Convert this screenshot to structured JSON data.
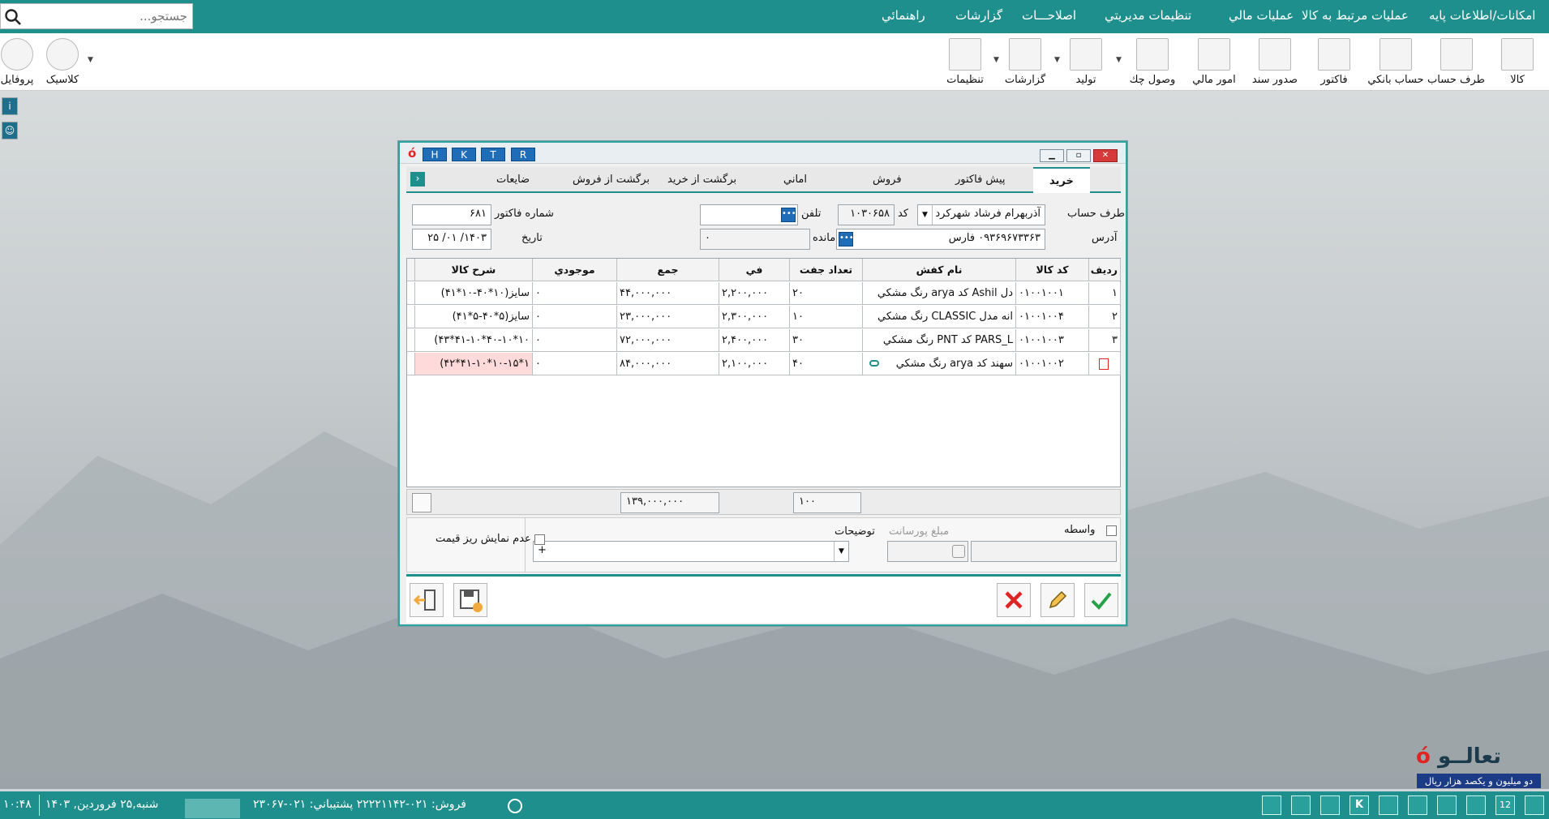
{
  "menu": {
    "items": [
      "امکانات/اطلاعات پايه",
      "عمليات مرتبط به کالا",
      "عمليات مالي",
      "تنظيمات مديريتي",
      "اصلاحـــات",
      "گزارشات",
      "راهنمائي"
    ],
    "search_placeholder": "جستجو..."
  },
  "toolbar": {
    "items": [
      "کالا",
      "طرف حساب",
      "حساب بانکي",
      "فاکتور",
      "صدور سند",
      "امور مالي",
      "وصول چك",
      "توليد",
      "گزارشات",
      "تنظيمات"
    ],
    "theme_label": "کلاسيک",
    "profile_label": "پروفايل"
  },
  "dialog": {
    "title_buttons": [
      "H",
      "K",
      "T",
      "R"
    ],
    "tabs": [
      "خريد",
      "پيش فاکتور",
      "فروش",
      "اماني",
      "برگشت از خريد",
      "برگشت از فروش",
      "ضايعات"
    ],
    "active_tab": "خريد",
    "form": {
      "account_label": "طرف حساب",
      "account_value": "آذربهرام فرشاد شهرکرد",
      "code_label": "کد",
      "code_value": "۱۰۳۰۶۵۸",
      "phone_label": "تلفن",
      "phone_value": "",
      "invoice_no_label": "شماره فاکتور",
      "invoice_no_value": "۶۸۱",
      "address_label": "آدرس",
      "address_value": "۰۹۳۶۹۶۷۳۳۶۳   فارس",
      "balance_label": "مانده",
      "balance_value": "۰",
      "date_label": "تاريخ",
      "date_value": "۱۴۰۳/ ۰۱/ ۲۵"
    },
    "table": {
      "headers": [
        "رديف",
        "کد کالا",
        "نام کفش",
        "تعداد جفت",
        "في",
        "جمع",
        "موجودي",
        "شرح کالا"
      ],
      "rows": [
        [
          "۱",
          "۰۱۰۰۱۰۰۱",
          "دل Ashil کد arya رنگ مشکي",
          "۲۰",
          "۲,۲۰۰,۰۰۰",
          "۴۴,۰۰۰,۰۰۰",
          "۰",
          "سايز(۱۰*۴۰-۱۰*۴۱)"
        ],
        [
          "۲",
          "۰۱۰۰۱۰۰۴",
          "انه مدل CLASSIC رنگ مشکي",
          "۱۰",
          "۲,۳۰۰,۰۰۰",
          "۲۳,۰۰۰,۰۰۰",
          "۰",
          "سايز(۵*۴۰-۵*۴۱)"
        ],
        [
          "۳",
          "۰۱۰۰۱۰۰۳",
          "PARS_L کد PNT رنگ مشکي",
          "۳۰",
          "۲,۴۰۰,۰۰۰",
          "۷۲,۰۰۰,۰۰۰",
          "۰",
          "۱۰*۴۰-۱۰*۴۱-۱۰*۴۳)"
        ],
        [
          "",
          "۰۱۰۰۱۰۰۲",
          "سهند کد arya رنگ مشکي",
          "۴۰",
          "۲,۱۰۰,۰۰۰",
          "۸۴,۰۰۰,۰۰۰",
          "۰",
          "۱*۱۰-۱۵*۴۱-۱۰*۴۲)"
        ]
      ]
    },
    "totals": {
      "pairs_total": "۱۰۰",
      "amount_total": "۱۳۹,۰۰۰,۰۰۰"
    },
    "bottom": {
      "intermediary_label": "واسطه",
      "commission_label": "مبلغ پورسانت",
      "notes_label": "توضيحات",
      "notes_value": "+",
      "hide_price_label": "عدم نمايش ريز قيمت"
    }
  },
  "brand": {
    "logo_text": "تعالــو",
    "amount_in_words": "دو ميليون  و يکصد هزار  ريال"
  },
  "status": {
    "datetime": "شنبه,۲۵ فروردين, ۱۴۰۳",
    "time": "۱۰:۴۸",
    "support": "فروش: ۰۲۱-۲۲۲۲۱۱۴۲ پشتيباني: ۰۲۱-۲۳۰۶۷",
    "calendar_day": "12"
  },
  "colors": {
    "teal": "#1e8f8c",
    "blue": "#1e6db6",
    "cancel_red": "#e02424",
    "confirm_green": "#27a14a"
  }
}
